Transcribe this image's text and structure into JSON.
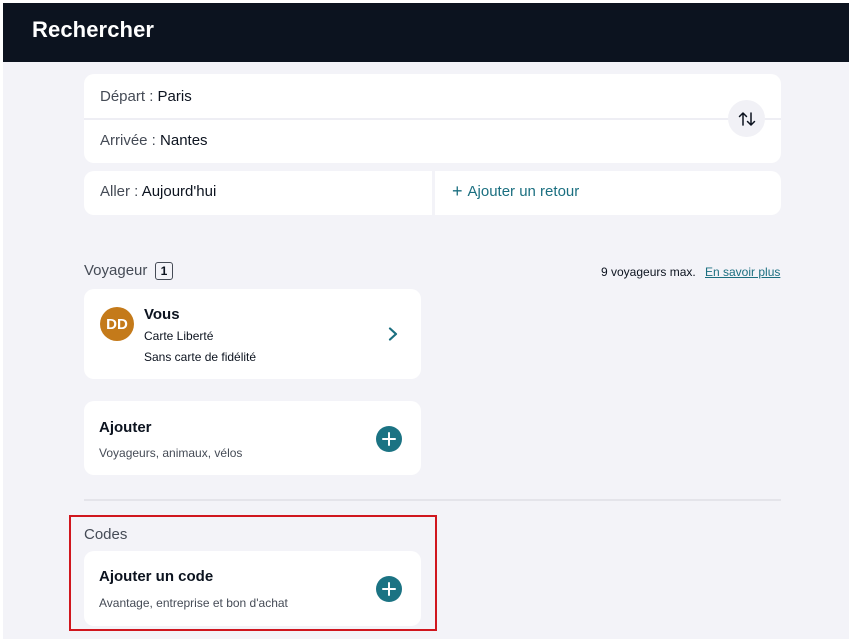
{
  "header": {
    "title": "Rechercher"
  },
  "route": {
    "departure_label": "Départ :",
    "departure_value": "Paris",
    "arrival_label": "Arrivée :",
    "arrival_value": "Nantes",
    "swap_icon": "swap-vertical-icon"
  },
  "dates": {
    "outbound_label": "Aller :",
    "outbound_value": "Aujourd'hui",
    "add_return_plus": "+",
    "add_return_label": "Ajouter un retour"
  },
  "travelers": {
    "title": "Voyageur",
    "count": "1",
    "max_text": "9 voyageurs max.",
    "learn_more": "En savoir plus",
    "traveler": {
      "initials": "DD",
      "name": "Vous",
      "card": "Carte Liberté",
      "loyalty": "Sans carte de fidélité"
    },
    "add": {
      "title": "Ajouter",
      "subtitle": "Voyageurs, animaux, vélos"
    }
  },
  "codes": {
    "title": "Codes",
    "add_title": "Ajouter un code",
    "add_subtitle": "Avantage, entreprise et bon d'achat"
  },
  "colors": {
    "header_bg": "#0c131f",
    "page_bg": "#f3f3f8",
    "accent": "#1b7383",
    "avatar": "#c47a1a",
    "highlight": "#d0161e"
  }
}
